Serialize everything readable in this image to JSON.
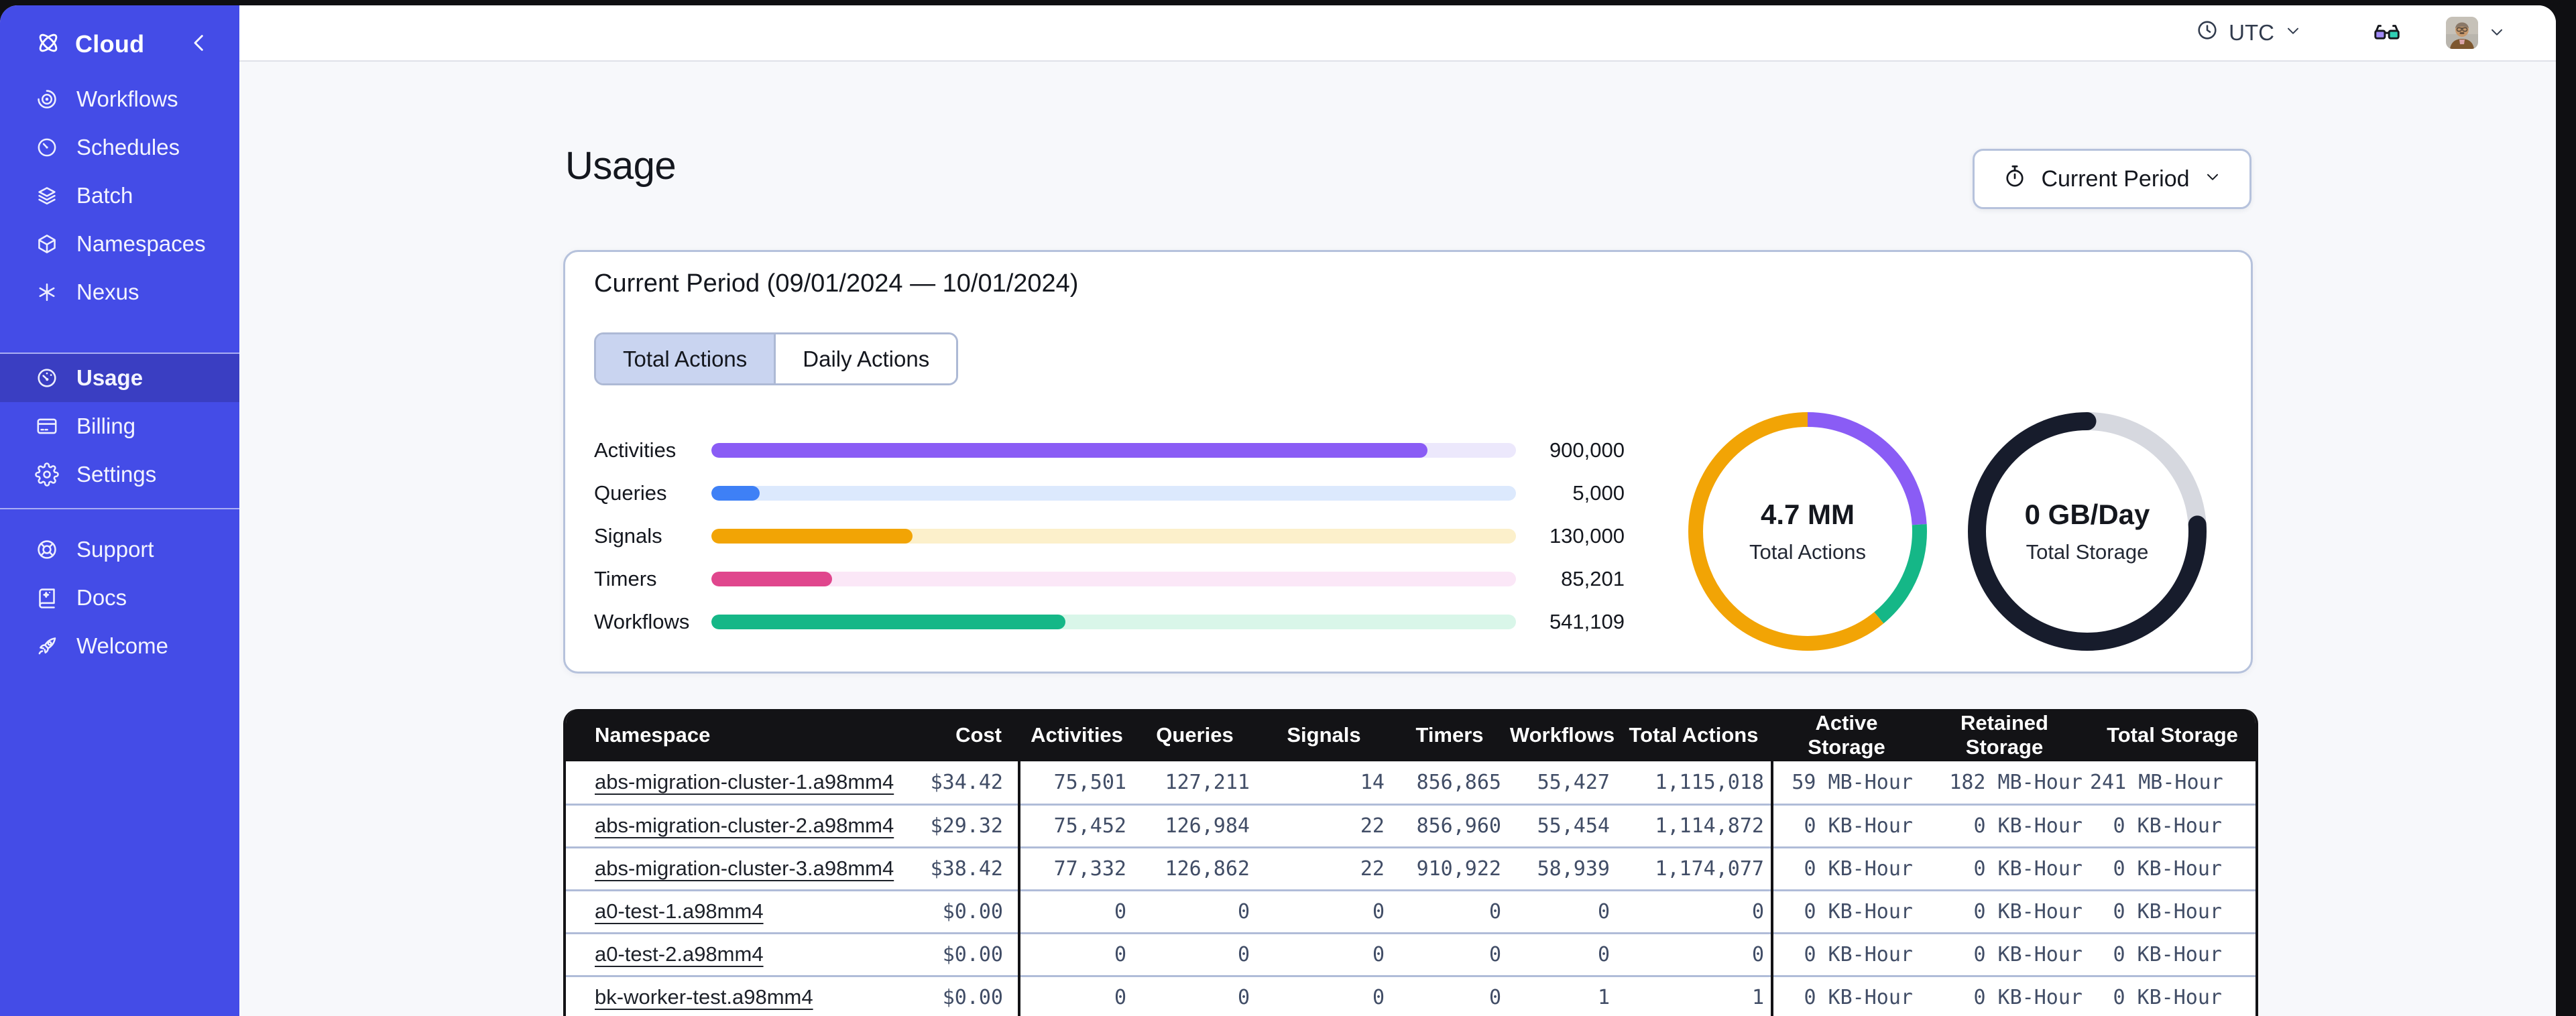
{
  "brand": {
    "name": "Cloud",
    "logo_icon": "temporal-logo-icon",
    "collapse_icon": "chevron-left-icon"
  },
  "sidebar": {
    "primary": [
      {
        "label": "Workflows",
        "icon": "workflows-icon",
        "active": false
      },
      {
        "label": "Schedules",
        "icon": "schedules-icon",
        "active": false
      },
      {
        "label": "Batch",
        "icon": "batch-icon",
        "active": false
      },
      {
        "label": "Namespaces",
        "icon": "namespaces-icon",
        "active": false
      },
      {
        "label": "Nexus",
        "icon": "nexus-icon",
        "active": false
      }
    ],
    "account": [
      {
        "label": "Usage",
        "icon": "usage-icon",
        "active": true
      },
      {
        "label": "Billing",
        "icon": "billing-icon",
        "active": false
      },
      {
        "label": "Settings",
        "icon": "settings-icon",
        "active": false
      }
    ],
    "footer": [
      {
        "label": "Support",
        "icon": "support-icon",
        "active": false
      },
      {
        "label": "Docs",
        "icon": "docs-icon",
        "active": false
      },
      {
        "label": "Welcome",
        "icon": "welcome-icon",
        "active": false
      }
    ]
  },
  "topbar": {
    "timezone": "UTC",
    "timezone_icon": "clock-icon",
    "caret_icon": "chevron-down-icon",
    "glasses_icon": "glasses-icon",
    "avatar_icon": "avatar"
  },
  "page": {
    "title": "Usage",
    "period_selector_label": "Current Period",
    "period_selector_icon": "stopwatch-icon"
  },
  "usage_card": {
    "title": "Current Period (09/01/2024 — 10/01/2024)",
    "tabs": [
      {
        "label": "Total Actions",
        "active": true
      },
      {
        "label": "Daily Actions",
        "active": false
      }
    ]
  },
  "chart_data": [
    {
      "type": "bar",
      "orientation": "horizontal",
      "title": "Total Actions by type",
      "categories": [
        "Activities",
        "Queries",
        "Signals",
        "Timers",
        "Workflows"
      ],
      "values": [
        900000,
        5000,
        130000,
        85201,
        541109
      ],
      "value_labels": [
        "900,000",
        "5,000",
        "130,000",
        "85,201",
        "541,109"
      ],
      "percent_of_track": [
        89,
        6,
        25,
        15,
        44
      ],
      "bar_colors": [
        "#8a5cf5",
        "#3e80f6",
        "#f2a405",
        "#e0468d",
        "#15b787"
      ],
      "track_colors": [
        "#ece8fc",
        "#dce9fd",
        "#fcf0cb",
        "#fbe7f7",
        "#d9f6e9"
      ],
      "grid": false,
      "legend": false
    },
    {
      "type": "donut",
      "center_value": "4.7 MM",
      "center_label": "Total Actions",
      "stroke_width": 22,
      "segments": [
        {
          "name": "purple-segment",
          "color": "#8a5cf5",
          "percent": 24
        },
        {
          "name": "green-segment",
          "color": "#15b787",
          "percent": 15
        },
        {
          "name": "orange-segment",
          "color": "#f2a405",
          "percent": 61
        }
      ]
    },
    {
      "type": "donut",
      "center_value": "0 GB/Day",
      "center_label": "Total Storage",
      "stroke_width": 27,
      "segments": [
        {
          "name": "light-segment",
          "color": "#d6d8df",
          "percent": 24
        },
        {
          "name": "dark-segment",
          "color": "#171c2c",
          "percent": 76,
          "linecap": "round"
        }
      ]
    }
  ],
  "table": {
    "columns": [
      {
        "label": "Namespace",
        "align": "left"
      },
      {
        "label": "Cost",
        "align": "right",
        "divider_after": true
      },
      {
        "label": "Activities",
        "align": "center"
      },
      {
        "label": "Queries",
        "align": "center"
      },
      {
        "label": "Signals",
        "align": "center"
      },
      {
        "label": "Timers",
        "align": "center"
      },
      {
        "label": "Workflows",
        "align": "center"
      },
      {
        "label": "Total Actions",
        "align": "center",
        "divider_after": true
      },
      {
        "label": "Active Storage",
        "align": "center"
      },
      {
        "label": "Retained Storage",
        "align": "center"
      },
      {
        "label": "Total Storage",
        "align": "center"
      }
    ],
    "rows": [
      [
        "abs-migration-cluster-1.a98mm4",
        "$34.42",
        "75,501",
        "127,211",
        "14",
        "856,865",
        "55,427",
        "1,115,018",
        "59 MB-Hour",
        "182 MB-Hour",
        "241 MB-Hour"
      ],
      [
        "abs-migration-cluster-2.a98mm4",
        "$29.32",
        "75,452",
        "126,984",
        "22",
        "856,960",
        "55,454",
        "1,114,872",
        "0 KB-Hour",
        "0 KB-Hour",
        "0 KB-Hour"
      ],
      [
        "abs-migration-cluster-3.a98mm4",
        "$38.42",
        "77,332",
        "126,862",
        "22",
        "910,922",
        "58,939",
        "1,174,077",
        "0 KB-Hour",
        "0 KB-Hour",
        "0 KB-Hour"
      ],
      [
        "a0-test-1.a98mm4",
        "$0.00",
        "0",
        "0",
        "0",
        "0",
        "0",
        "0",
        "0 KB-Hour",
        "0 KB-Hour",
        "0 KB-Hour"
      ],
      [
        "a0-test-2.a98mm4",
        "$0.00",
        "0",
        "0",
        "0",
        "0",
        "0",
        "0",
        "0 KB-Hour",
        "0 KB-Hour",
        "0 KB-Hour"
      ],
      [
        "bk-worker-test.a98mm4",
        "$0.00",
        "0",
        "0",
        "0",
        "0",
        "1",
        "1",
        "0 KB-Hour",
        "0 KB-Hour",
        "0 KB-Hour"
      ]
    ]
  },
  "colors": {
    "sidebar": "#444ce7",
    "sidebar_active": "#3a3ec2",
    "card_border": "#b6c2dc",
    "tab_selected": "#c9d4f0",
    "table_header_bg": "#131316",
    "row_border": "#b0bcd8",
    "numeric_text": "#414d66",
    "link_text": "#1d2129",
    "content_bg": "#f7f8fb",
    "accent_text": "#15181f",
    "window_bg": "#0f0f12"
  }
}
